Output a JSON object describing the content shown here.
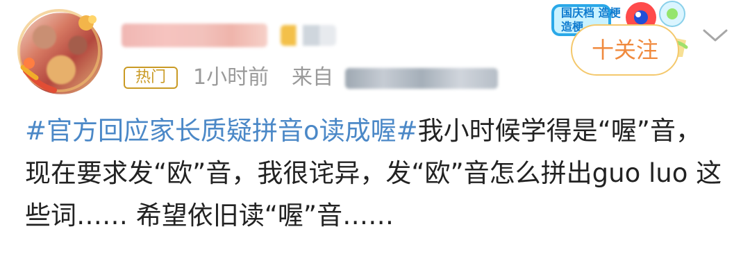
{
  "user": {
    "avatar_icon": "avatar-icon",
    "username": "",
    "badge": ""
  },
  "meta": {
    "hot_label": "热门",
    "time_label": "1小时前",
    "source_label": "来自"
  },
  "actions": {
    "follow_label": "十关注",
    "more_icon": "chevron-down-icon"
  },
  "promo": {
    "text": "国庆档 造梗"
  },
  "post": {
    "topic": "#官方回应家长质疑拼音o读成喔#",
    "body": "我小时候学得是“喔”音，现在要求发“欧”音，我很诧异，发“欧”音怎么拼出guo luo 这些词…… 希望依旧读“喔”音……"
  },
  "colors": {
    "topic_blue": "#4b88c7",
    "hot_gold": "#c99a24",
    "follow_orange": "#f08a3e",
    "meta_gray": "#9a9a9a"
  }
}
